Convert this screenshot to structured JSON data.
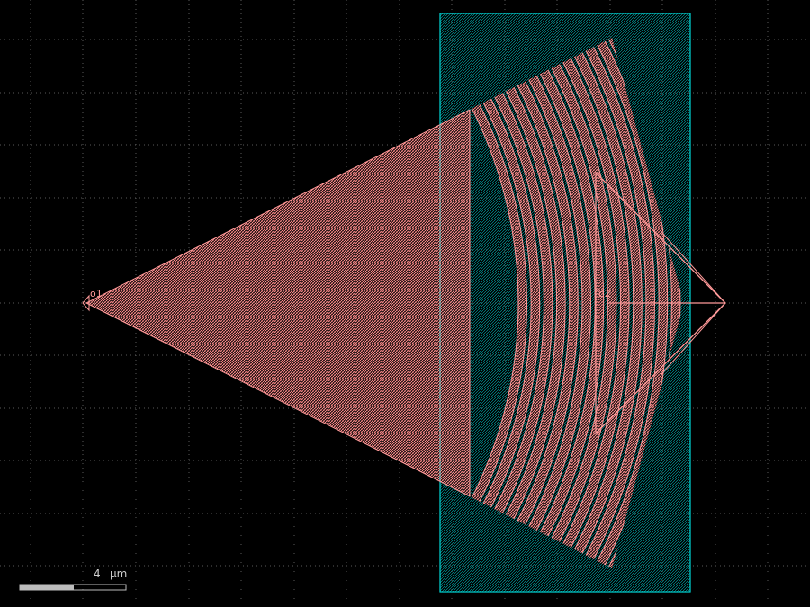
{
  "viewer": {
    "background": "#000000",
    "grid_color": "#5a5a5a",
    "grid_style": "dotted"
  },
  "layers": {
    "core_color": "#ff8c8c",
    "cladding_color": "#00c8c8"
  },
  "ports": [
    {
      "name": "o1"
    },
    {
      "name": "o2"
    }
  ],
  "grating": {
    "ring_count": 13
  },
  "scale_bar": {
    "value": "4",
    "unit": "µm"
  }
}
